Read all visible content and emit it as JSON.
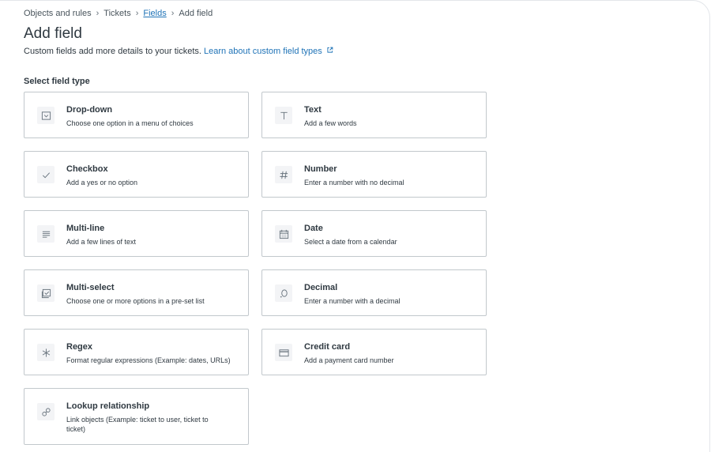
{
  "breadcrumb": {
    "item1": "Objects and rules",
    "item2": "Tickets",
    "item3": "Fields",
    "item4": "Add field"
  },
  "page": {
    "title": "Add field",
    "subtitle": "Custom fields add more details to your tickets.",
    "learn_link": "Learn about custom field types"
  },
  "section_label": "Select field type",
  "fields": [
    {
      "name": "Drop-down",
      "desc": "Choose one option in a menu of choices",
      "icon": "dropdown-icon"
    },
    {
      "name": "Text",
      "desc": "Add a few words",
      "icon": "text-icon"
    },
    {
      "name": "Checkbox",
      "desc": "Add a yes or no option",
      "icon": "checkmark-icon"
    },
    {
      "name": "Number",
      "desc": "Enter a number with no decimal",
      "icon": "hash-icon"
    },
    {
      "name": "Multi-line",
      "desc": "Add a few lines of text",
      "icon": "lines-icon"
    },
    {
      "name": "Date",
      "desc": "Select a date from a calendar",
      "icon": "calendar-icon"
    },
    {
      "name": "Multi-select",
      "desc": "Choose one or more options in a pre-set list",
      "icon": "multiselect-icon"
    },
    {
      "name": "Decimal",
      "desc": "Enter a number with a decimal",
      "icon": "decimal-icon"
    },
    {
      "name": "Regex",
      "desc": "Format regular expressions (Example: dates, URLs)",
      "icon": "asterisk-icon"
    },
    {
      "name": "Credit card",
      "desc": "Add a payment card number",
      "icon": "credit-card-icon"
    },
    {
      "name": "Lookup relationship",
      "desc": "Link objects (Example: ticket to user, ticket to ticket)",
      "icon": "link-icon"
    }
  ],
  "colors": {
    "link": "#1f73b7",
    "border": "#c2c8cc",
    "text": "#2f3941"
  }
}
